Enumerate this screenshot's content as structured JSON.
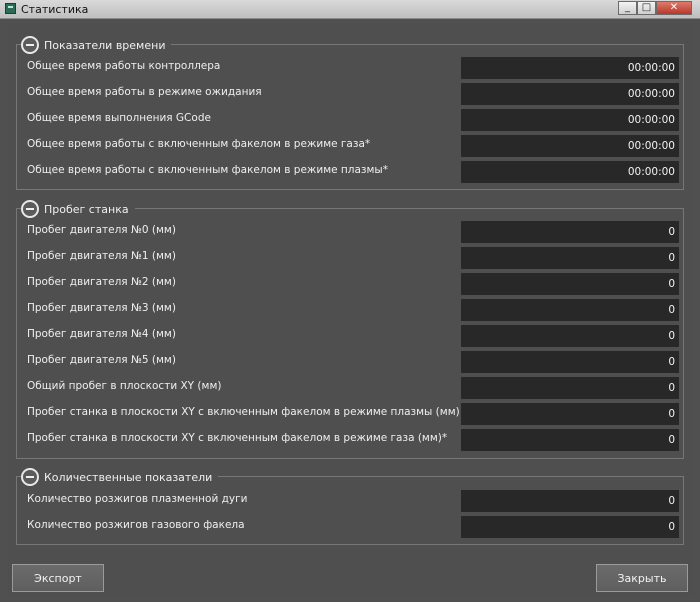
{
  "window": {
    "title": "Статистика"
  },
  "groups": [
    {
      "title": "Показатели времени",
      "rows": [
        {
          "label": "Общее время работы контроллера",
          "value": "00:00:00"
        },
        {
          "label": "Общее время работы в режиме ожидания",
          "value": "00:00:00"
        },
        {
          "label": "Общее время выполнения GCode",
          "value": "00:00:00"
        },
        {
          "label": "Общее время работы с включенным факелом в режиме газа*",
          "value": "00:00:00"
        },
        {
          "label": "Общее время работы с включенным факелом в режиме плазмы*",
          "value": "00:00:00"
        }
      ]
    },
    {
      "title": "Пробег станка",
      "rows": [
        {
          "label": "Пробег двигателя №0 (мм)",
          "value": "0"
        },
        {
          "label": "Пробег двигателя №1 (мм)",
          "value": "0"
        },
        {
          "label": "Пробег двигателя №2 (мм)",
          "value": "0"
        },
        {
          "label": "Пробег двигателя №3 (мм)",
          "value": "0"
        },
        {
          "label": "Пробег двигателя №4 (мм)",
          "value": "0"
        },
        {
          "label": "Пробег двигателя №5 (мм)",
          "value": "0"
        },
        {
          "label": "Общий пробег в плоскости XY (мм)",
          "value": "0"
        },
        {
          "label": "Пробег станка в плоскости XY с включенным факелом в режиме плазмы (мм)",
          "value": "0"
        },
        {
          "label": "Пробег станка в плоскости XY с включенным факелом в режиме газа (мм)*",
          "value": "0"
        }
      ]
    },
    {
      "title": "Количественные показатели",
      "rows": [
        {
          "label": "Количество розжигов плазменной дуги",
          "value": "0"
        },
        {
          "label": "Количество розжигов газового факела",
          "value": "0"
        }
      ]
    }
  ],
  "buttons": {
    "export": "Экспорт",
    "close": "Закрыть"
  },
  "window_controls": {
    "minimize": "_",
    "maximize": "□",
    "close": "✕"
  }
}
